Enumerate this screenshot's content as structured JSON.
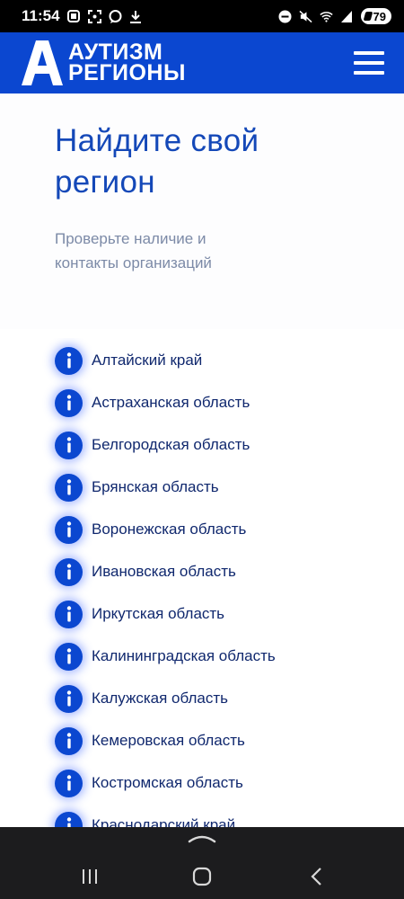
{
  "status_bar": {
    "time": "11:54",
    "battery": "79",
    "icons_left": [
      "notification-icon",
      "screenshot-icon",
      "chat-icon",
      "download-icon"
    ],
    "icons_right": [
      "dnd-icon",
      "mute-icon",
      "wifi-icon",
      "signal-icon"
    ]
  },
  "header": {
    "logo_line1": "АУТИЗМ",
    "logo_line2": "РЕГИОНЫ",
    "brand_color": "#0b47d0"
  },
  "hero": {
    "title": "Найдите свой регион",
    "subtitle": "Проверьте наличие и контакты организаций"
  },
  "regions": [
    "Алтайский край",
    "Астраханская область",
    "Белгородская область",
    "Брянская область",
    "Воронежская область",
    "Ивановская область",
    "Иркутская область",
    "Калининградская область",
    "Калужская область",
    "Кемеровская область",
    "Костромская область",
    "Краснодарский край"
  ],
  "colors": {
    "title": "#1448b8",
    "subtitle": "#7c8aa7",
    "item_text": "#10286e",
    "navbar": "#1c1c1e"
  }
}
